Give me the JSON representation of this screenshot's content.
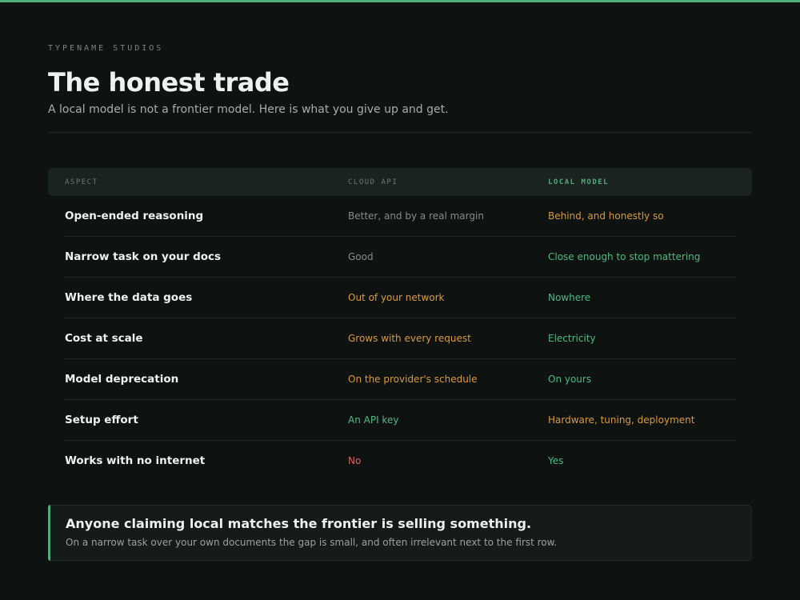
{
  "brand": "TYPENAME STUDIOS",
  "title": "The honest trade",
  "subtitle": "A local model is not a frontier model. Here is what you give up and get.",
  "table": {
    "headers": {
      "aspect": "ASPECT",
      "cloud": "CLOUD API",
      "local": "LOCAL MODEL"
    },
    "rows": [
      {
        "aspect": "Open-ended reasoning",
        "cloud": "Better, and by a real margin",
        "cloud_tone": "neutral",
        "local": "Behind, and honestly so",
        "local_tone": "warn"
      },
      {
        "aspect": "Narrow task on your docs",
        "cloud": "Good",
        "cloud_tone": "neutral",
        "local": "Close enough to stop mattering",
        "local_tone": "good"
      },
      {
        "aspect": "Where the data goes",
        "cloud": "Out of your network",
        "cloud_tone": "warn",
        "local": "Nowhere",
        "local_tone": "good"
      },
      {
        "aspect": "Cost at scale",
        "cloud": "Grows with every request",
        "cloud_tone": "warn",
        "local": "Electricity",
        "local_tone": "good"
      },
      {
        "aspect": "Model deprecation",
        "cloud": "On the provider's schedule",
        "cloud_tone": "warn",
        "local": "On yours",
        "local_tone": "good"
      },
      {
        "aspect": "Setup effort",
        "cloud": "An API key",
        "cloud_tone": "good",
        "local": "Hardware, tuning, deployment",
        "local_tone": "warn"
      },
      {
        "aspect": "Works with no internet",
        "cloud": "No",
        "cloud_tone": "bad",
        "local": "Yes",
        "local_tone": "good"
      }
    ]
  },
  "callout": {
    "title": "Anyone claiming local matches the frontier is selling something.",
    "body": "On a narrow task over your own documents the gap is small, and often irrelevant next to the first row."
  },
  "colors": {
    "accent": "#4fae7c",
    "warn": "#d9993f",
    "good": "#4fb884",
    "bad": "#e0605a",
    "background": "#0e1311"
  }
}
